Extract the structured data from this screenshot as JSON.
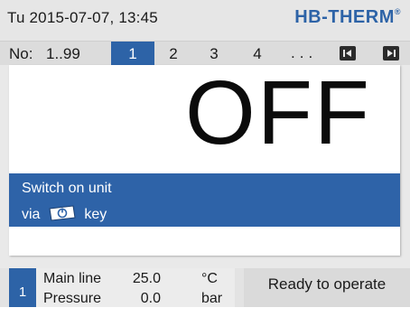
{
  "header": {
    "datetime": "Tu  2015-07-07, 13:45",
    "brand": "HB-THERM",
    "brand_mark": "®",
    "brand_color": "#2d63a7"
  },
  "unit_selector": {
    "label": "No:",
    "range": "1..99",
    "tabs": [
      "1",
      "2",
      "3",
      "4"
    ],
    "active_tab": "1",
    "ellipsis": "...",
    "nav_prev_icon": "skip-back-icon",
    "nav_next_icon": "skip-forward-icon"
  },
  "status": {
    "state": "OFF",
    "message_line1": "Switch on unit",
    "message_via": "via",
    "message_key": "key",
    "key_icon": "power-key-icon",
    "accent_color": "#2e63a8"
  },
  "footer": {
    "unit_number": "1",
    "params": [
      {
        "label": "Main line",
        "value": "25.0",
        "unit": "°C"
      },
      {
        "label": "Pressure",
        "value": "0.0",
        "unit": "bar"
      }
    ],
    "ready_text": "Ready to operate"
  }
}
